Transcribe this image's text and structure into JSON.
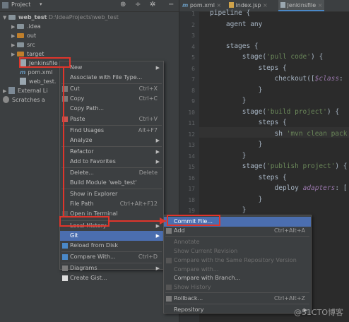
{
  "project_panel": {
    "title": "Project",
    "tree": [
      {
        "label": "web_test",
        "detail": "D:\\IdeaProjects\\web_test",
        "type": "project"
      },
      {
        "label": ".idea",
        "type": "folder"
      },
      {
        "label": "out",
        "type": "folder-orange"
      },
      {
        "label": "src",
        "type": "folder"
      },
      {
        "label": "target",
        "type": "folder-orange"
      },
      {
        "label": "Jenkinsfile",
        "type": "file"
      },
      {
        "label": "pom.xml",
        "type": "maven"
      },
      {
        "label": "web_test.",
        "type": "file"
      },
      {
        "label": "External Li",
        "type": "lib"
      },
      {
        "label": "Scratches a",
        "type": "scratch"
      }
    ]
  },
  "editor": {
    "tabs": [
      "pom.xml",
      "index.jsp",
      "Jenkinsfile"
    ],
    "line_numbers": [
      "1",
      "2",
      "3",
      "4",
      "5",
      "6",
      "7",
      "8",
      "9",
      "10",
      "11",
      "12",
      "13",
      "14",
      "15",
      "16",
      "17",
      "18",
      "19",
      "20"
    ],
    "lines": [
      {
        "text": "pipeline {"
      },
      {
        "text": "    agent any"
      },
      {
        "text": ""
      },
      {
        "text": "    stages {"
      },
      {
        "pre": "        stage(",
        "str": "'pull code'",
        "post": ") {"
      },
      {
        "text": "            steps {"
      },
      {
        "pre": "                checkout([",
        "it": "$class",
        "post": ":"
      },
      {
        "text": "            }"
      },
      {
        "text": "        }"
      },
      {
        "pre": "        stage(",
        "str": "'build project'",
        "post": ") {"
      },
      {
        "text": "            steps {"
      },
      {
        "pre": "                sh ",
        "str": "'mvn clean pack",
        "post": ""
      },
      {
        "text": "            }"
      },
      {
        "text": "        }"
      },
      {
        "pre": "        stage(",
        "str": "'publish project'",
        "post": ") {"
      },
      {
        "text": "            steps {"
      },
      {
        "pre": "                deploy ",
        "it": "adapters",
        "post": ": ["
      },
      {
        "text": "            }"
      },
      {
        "text": "        }"
      },
      {
        "text": "    }"
      }
    ]
  },
  "context_menu": {
    "items": [
      {
        "label": "New",
        "shortcut": "",
        "submenu": true
      },
      {
        "label": "Associate with File Type...",
        "shortcut": ""
      },
      {
        "sep": true
      },
      {
        "label": "Cut",
        "shortcut": "Ctrl+X"
      },
      {
        "label": "Copy",
        "shortcut": "Ctrl+C"
      },
      {
        "label": "Copy Path...",
        "shortcut": ""
      },
      {
        "label": "Paste",
        "shortcut": "Ctrl+V"
      },
      {
        "sep": true
      },
      {
        "label": "Find Usages",
        "shortcut": "Alt+F7"
      },
      {
        "label": "Analyze",
        "shortcut": "",
        "submenu": true
      },
      {
        "sep": true
      },
      {
        "label": "Refactor",
        "shortcut": "",
        "submenu": true
      },
      {
        "label": "Add to Favorites",
        "shortcut": "",
        "submenu": true
      },
      {
        "sep": true
      },
      {
        "label": "Delete...",
        "shortcut": "Delete"
      },
      {
        "label": "Build Module 'web_test'",
        "shortcut": ""
      },
      {
        "sep": true
      },
      {
        "label": "Show in Explorer",
        "shortcut": ""
      },
      {
        "label": "File Path",
        "shortcut": "Ctrl+Alt+F12"
      },
      {
        "label": "Open in Terminal",
        "shortcut": ""
      },
      {
        "sep": true
      },
      {
        "label": "Local History",
        "shortcut": "",
        "submenu": true
      },
      {
        "label": "Git",
        "shortcut": "",
        "submenu": true,
        "selected": true
      },
      {
        "label": "Reload from Disk",
        "shortcut": ""
      },
      {
        "sep": true
      },
      {
        "label": "Compare With...",
        "shortcut": "Ctrl+D"
      },
      {
        "sep": true
      },
      {
        "label": "Diagrams",
        "shortcut": "",
        "submenu": true
      },
      {
        "label": "Create Gist...",
        "shortcut": ""
      }
    ]
  },
  "git_submenu": {
    "items": [
      {
        "label": "Commit File...",
        "shortcut": "",
        "selected": true
      },
      {
        "label": "Add",
        "shortcut": "Ctrl+Alt+A"
      },
      {
        "sep": true
      },
      {
        "label": "Annotate",
        "shortcut": "",
        "disabled": true
      },
      {
        "label": "Show Current Revision",
        "shortcut": "",
        "disabled": true
      },
      {
        "label": "Compare with the Same Repository Version",
        "shortcut": "",
        "disabled": true
      },
      {
        "label": "Compare with...",
        "shortcut": "",
        "disabled": true
      },
      {
        "label": "Compare with Branch...",
        "shortcut": ""
      },
      {
        "label": "Show History",
        "shortcut": "",
        "disabled": true
      },
      {
        "sep": true
      },
      {
        "label": "Rollback...",
        "shortcut": "Ctrl+Alt+Z"
      },
      {
        "sep": true
      },
      {
        "label": "Repository",
        "shortcut": "",
        "submenu": true
      }
    ]
  },
  "watermark": "@51CTO博客",
  "colors": {
    "accent": "#4b6eaf",
    "highlight_box": "#e0352b"
  }
}
